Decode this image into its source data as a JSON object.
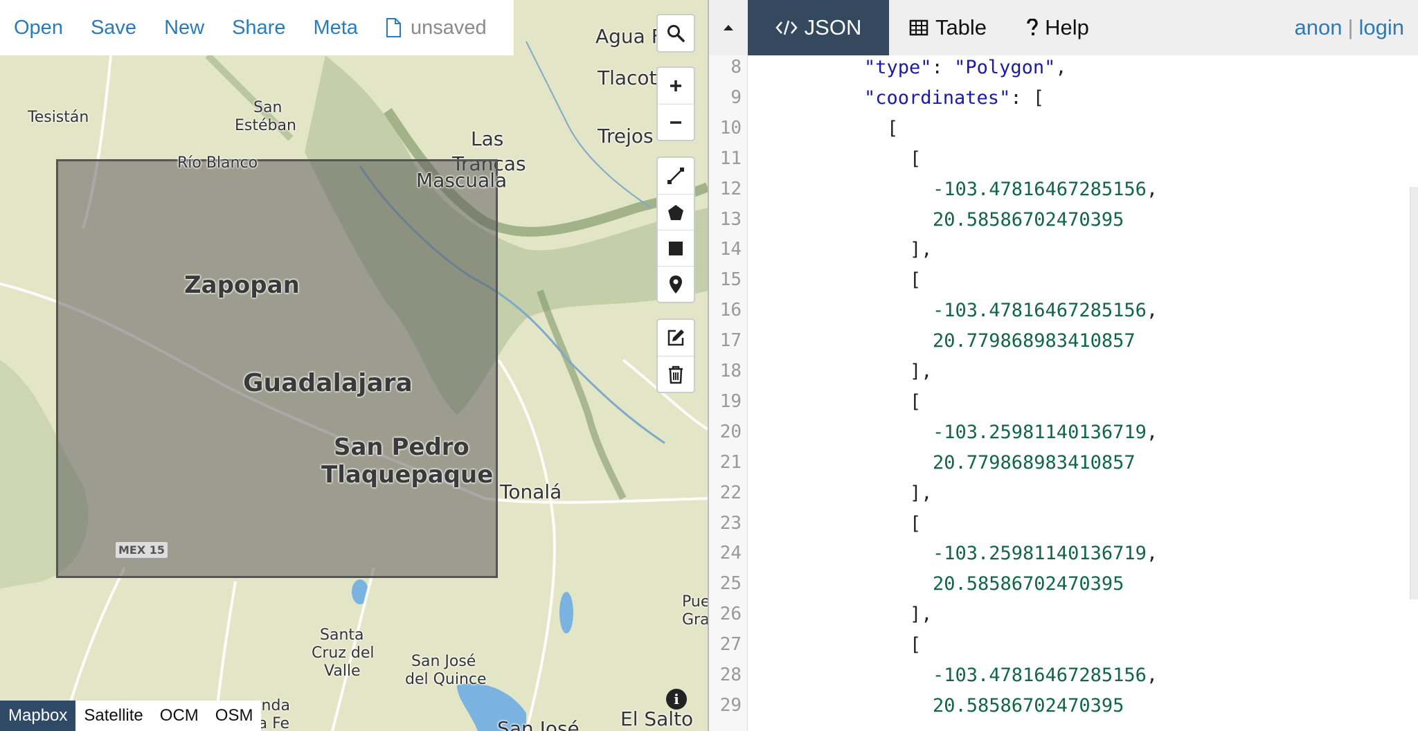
{
  "menu": {
    "open": "Open",
    "save": "Save",
    "new": "New",
    "share": "Share",
    "meta": "Meta",
    "file_status": "unsaved"
  },
  "places": {
    "agua": "Agua F",
    "tlacot": "Tlacot",
    "trejos": "Trejos",
    "tesistan": "Tesistán",
    "san_esteban_1": "San",
    "san_esteban_2": "Estéban",
    "rio_blanco": "Río Blanco",
    "las": "Las",
    "trancas": "Trancas",
    "mascuala": "Mascuala",
    "zapopan": "Zapopan",
    "guadalajara": "Guadalajara",
    "san_pedro_1": "San Pedro",
    "san_pedro_2": "Tlaquepaque",
    "tonala": "Tonalá",
    "mex15": "MEX 15",
    "santa_cruz_1": "Santa",
    "santa_cruz_2": "Cruz del",
    "santa_cruz_3": "Valle",
    "san_jose_1": "San José",
    "san_jose_2": "del Quince",
    "san_jose_bottom": "San José",
    "pue": "Pue",
    "gra": "Gra",
    "hacienda_1": "enda",
    "hacienda_2": "ta Fe",
    "el_salto": "El Salto"
  },
  "layers": [
    "Mapbox",
    "Satellite",
    "OCM",
    "OSM"
  ],
  "active_layer": "Mapbox",
  "tabs": {
    "json": "JSON",
    "table": "Table",
    "help": "Help"
  },
  "user": {
    "anon": "anon",
    "separator": "|",
    "login": "login"
  },
  "editor": {
    "line_numbers": [
      "8",
      "9",
      "10",
      "11",
      "12",
      "13",
      "14",
      "15",
      "16",
      "17",
      "18",
      "19",
      "20",
      "21",
      "22",
      "23",
      "24",
      "25",
      "26",
      "27",
      "28",
      "29"
    ],
    "lines": [
      {
        "indent": 8,
        "parts": [
          {
            "t": "\"type\"",
            "c": "str"
          },
          {
            "t": ": ",
            "c": ""
          },
          {
            "t": "\"Polygon\"",
            "c": "str"
          },
          {
            "t": ",",
            "c": ""
          }
        ]
      },
      {
        "indent": 8,
        "parts": [
          {
            "t": "\"coordinates\"",
            "c": "str"
          },
          {
            "t": ": [",
            "c": ""
          }
        ]
      },
      {
        "indent": 10,
        "parts": [
          {
            "t": "[",
            "c": ""
          }
        ]
      },
      {
        "indent": 12,
        "parts": [
          {
            "t": "[",
            "c": ""
          }
        ]
      },
      {
        "indent": 14,
        "parts": [
          {
            "t": "-103.47816467285156",
            "c": "num"
          },
          {
            "t": ",",
            "c": ""
          }
        ]
      },
      {
        "indent": 14,
        "parts": [
          {
            "t": "20.58586702470395",
            "c": "num"
          }
        ]
      },
      {
        "indent": 12,
        "parts": [
          {
            "t": "],",
            "c": ""
          }
        ]
      },
      {
        "indent": 12,
        "parts": [
          {
            "t": "[",
            "c": ""
          }
        ]
      },
      {
        "indent": 14,
        "parts": [
          {
            "t": "-103.47816467285156",
            "c": "num"
          },
          {
            "t": ",",
            "c": ""
          }
        ]
      },
      {
        "indent": 14,
        "parts": [
          {
            "t": "20.779868983410857",
            "c": "num"
          }
        ]
      },
      {
        "indent": 12,
        "parts": [
          {
            "t": "],",
            "c": ""
          }
        ]
      },
      {
        "indent": 12,
        "parts": [
          {
            "t": "[",
            "c": ""
          }
        ]
      },
      {
        "indent": 14,
        "parts": [
          {
            "t": "-103.25981140136719",
            "c": "num"
          },
          {
            "t": ",",
            "c": ""
          }
        ]
      },
      {
        "indent": 14,
        "parts": [
          {
            "t": "20.779868983410857",
            "c": "num"
          }
        ]
      },
      {
        "indent": 12,
        "parts": [
          {
            "t": "],",
            "c": ""
          }
        ]
      },
      {
        "indent": 12,
        "parts": [
          {
            "t": "[",
            "c": ""
          }
        ]
      },
      {
        "indent": 14,
        "parts": [
          {
            "t": "-103.25981140136719",
            "c": "num"
          },
          {
            "t": ",",
            "c": ""
          }
        ]
      },
      {
        "indent": 14,
        "parts": [
          {
            "t": "20.58586702470395",
            "c": "num"
          }
        ]
      },
      {
        "indent": 12,
        "parts": [
          {
            "t": "],",
            "c": ""
          }
        ]
      },
      {
        "indent": 12,
        "parts": [
          {
            "t": "[",
            "c": ""
          }
        ]
      },
      {
        "indent": 14,
        "parts": [
          {
            "t": "-103.47816467285156",
            "c": "num"
          },
          {
            "t": ",",
            "c": ""
          }
        ]
      },
      {
        "indent": 14,
        "parts": [
          {
            "t": "20.58586702470395",
            "c": "num"
          }
        ]
      }
    ]
  },
  "colors": {
    "accent": "#2b7bb9",
    "tab_active": "#34495e",
    "json_string": "#1a1aa6",
    "json_number": "#116644"
  },
  "icons": {
    "file": "file-icon",
    "search": "search-icon",
    "zoom_in": "plus-icon",
    "zoom_out": "minus-icon",
    "line": "draw-line-icon",
    "polygon": "draw-polygon-icon",
    "rectangle": "draw-rectangle-icon",
    "marker": "marker-icon",
    "edit": "edit-icon",
    "delete": "trash-icon",
    "info": "info-icon",
    "collapse": "caret-up-icon",
    "json": "code-icon",
    "table": "table-icon",
    "help": "question-icon"
  }
}
